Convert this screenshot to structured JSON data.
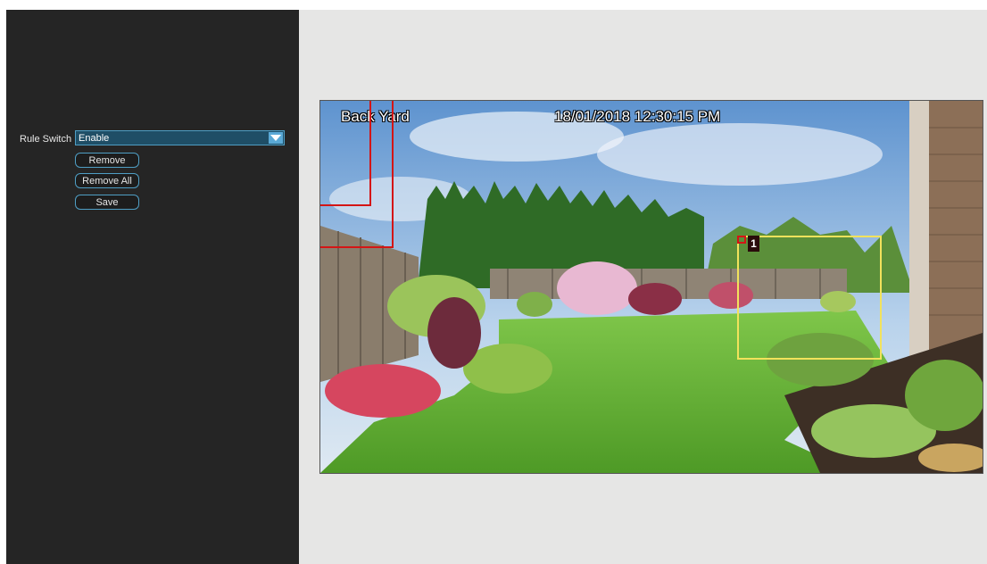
{
  "settings": {
    "rule_switch_label": "Rule Switch",
    "rule_switch_value": "Enable",
    "remove_label": "Remove",
    "remove_all_label": "Remove All",
    "save_label": "Save"
  },
  "camera": {
    "name": "Back Yard",
    "timestamp": "18/01/2018 12:30:15 PM",
    "zone_number": "1"
  },
  "colors": {
    "panel": "#252525",
    "accent": "#4f9ec4",
    "zone_yellow": "#f2e25c",
    "zone_red": "#d41515"
  },
  "icons": {
    "dropdown": "triangle-down-icon"
  }
}
